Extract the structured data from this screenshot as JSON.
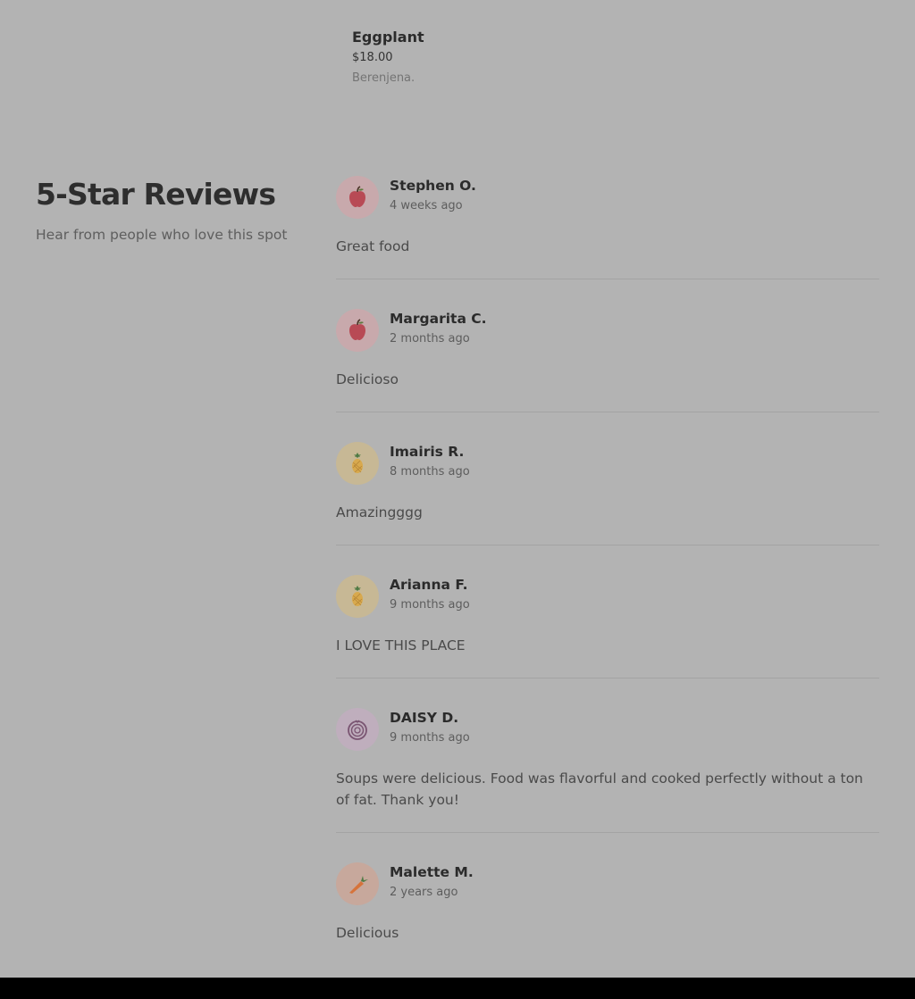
{
  "menu": {
    "item": {
      "name": "Eggplant",
      "price": "$18.00",
      "description": "Berenjena."
    }
  },
  "reviews_section": {
    "title": "5-Star Reviews",
    "subtitle": "Hear from people who love this spot"
  },
  "reviews": [
    {
      "name": "Stephen O.",
      "time": "4 weeks ago",
      "text": "Great food",
      "avatar": "apple-icon",
      "avatar_bg": "#c8a9ac"
    },
    {
      "name": "Margarita C.",
      "time": "2 months ago",
      "text": "Delicioso",
      "avatar": "apple-icon",
      "avatar_bg": "#c8a9ac"
    },
    {
      "name": "Imairis R.",
      "time": "8 months ago",
      "text": "Amazingggg",
      "avatar": "pineapple-icon",
      "avatar_bg": "#c7b895"
    },
    {
      "name": "Arianna F.",
      "time": "9 months ago",
      "text": "I LOVE THIS PLACE",
      "avatar": "pineapple-icon",
      "avatar_bg": "#c7b895"
    },
    {
      "name": "DAISY D.",
      "time": "9 months ago",
      "text": "Soups were delicious. Food was flavorful and cooked perfectly without a ton of fat. Thank you!",
      "avatar": "onion-icon",
      "avatar_bg": "#bfaebd"
    },
    {
      "name": "Malette M.",
      "time": "2 years ago",
      "text": "Delicious",
      "avatar": "carrot-icon",
      "avatar_bg": "#c7a89c"
    }
  ]
}
